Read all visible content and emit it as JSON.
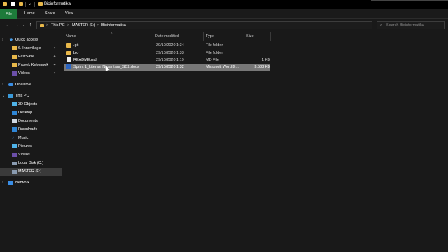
{
  "window": {
    "title": "Bioinformatika"
  },
  "ribbon": {
    "tabs": [
      "File",
      "Home",
      "Share",
      "View"
    ]
  },
  "address": {
    "crumbs": [
      "This PC",
      "MASTER (E:)",
      "Bioinformatika"
    ],
    "separator": ">",
    "search_placeholder": "Search Bioinformatika"
  },
  "sidebar": {
    "quick_access": "Quick access",
    "pinned": [
      "6. Innovillage",
      "FastSave",
      "Proyek Kelompok",
      "Videos"
    ],
    "onedrive": "OneDrive",
    "this_pc": "This PC",
    "pc_items": [
      "3D Objects",
      "Desktop",
      "Documents",
      "Downloads",
      "Music",
      "Pictures",
      "Videos",
      "Local Disk (C:)",
      "MASTER (E:)"
    ],
    "network": "Network"
  },
  "columns": {
    "name": "Name",
    "date": "Date modified",
    "type": "Type",
    "size": "Size"
  },
  "files": [
    {
      "name": ".git",
      "date": "29/10/2020 1:34",
      "type": "File folder",
      "size": "",
      "icon": "folder-icon"
    },
    {
      "name": "bio",
      "date": "29/10/2020 1:33",
      "type": "File folder",
      "size": "",
      "icon": "folder-icon"
    },
    {
      "name": "README.md",
      "date": "29/10/2020 1:19",
      "type": "MD File",
      "size": "1 KB",
      "icon": "md-file-icon"
    },
    {
      "name": "Sprint 1_Literasi Nusantara_SC2.docx",
      "date": "29/10/2020 1:32",
      "type": "Microsoft Word D...",
      "size": "3.533 KB",
      "icon": "word-doc-icon"
    }
  ],
  "colors": {
    "file_tab": "#1d7a3a",
    "folder": "#e8b84a",
    "selection": "#777777",
    "word": "#2b65c2"
  }
}
